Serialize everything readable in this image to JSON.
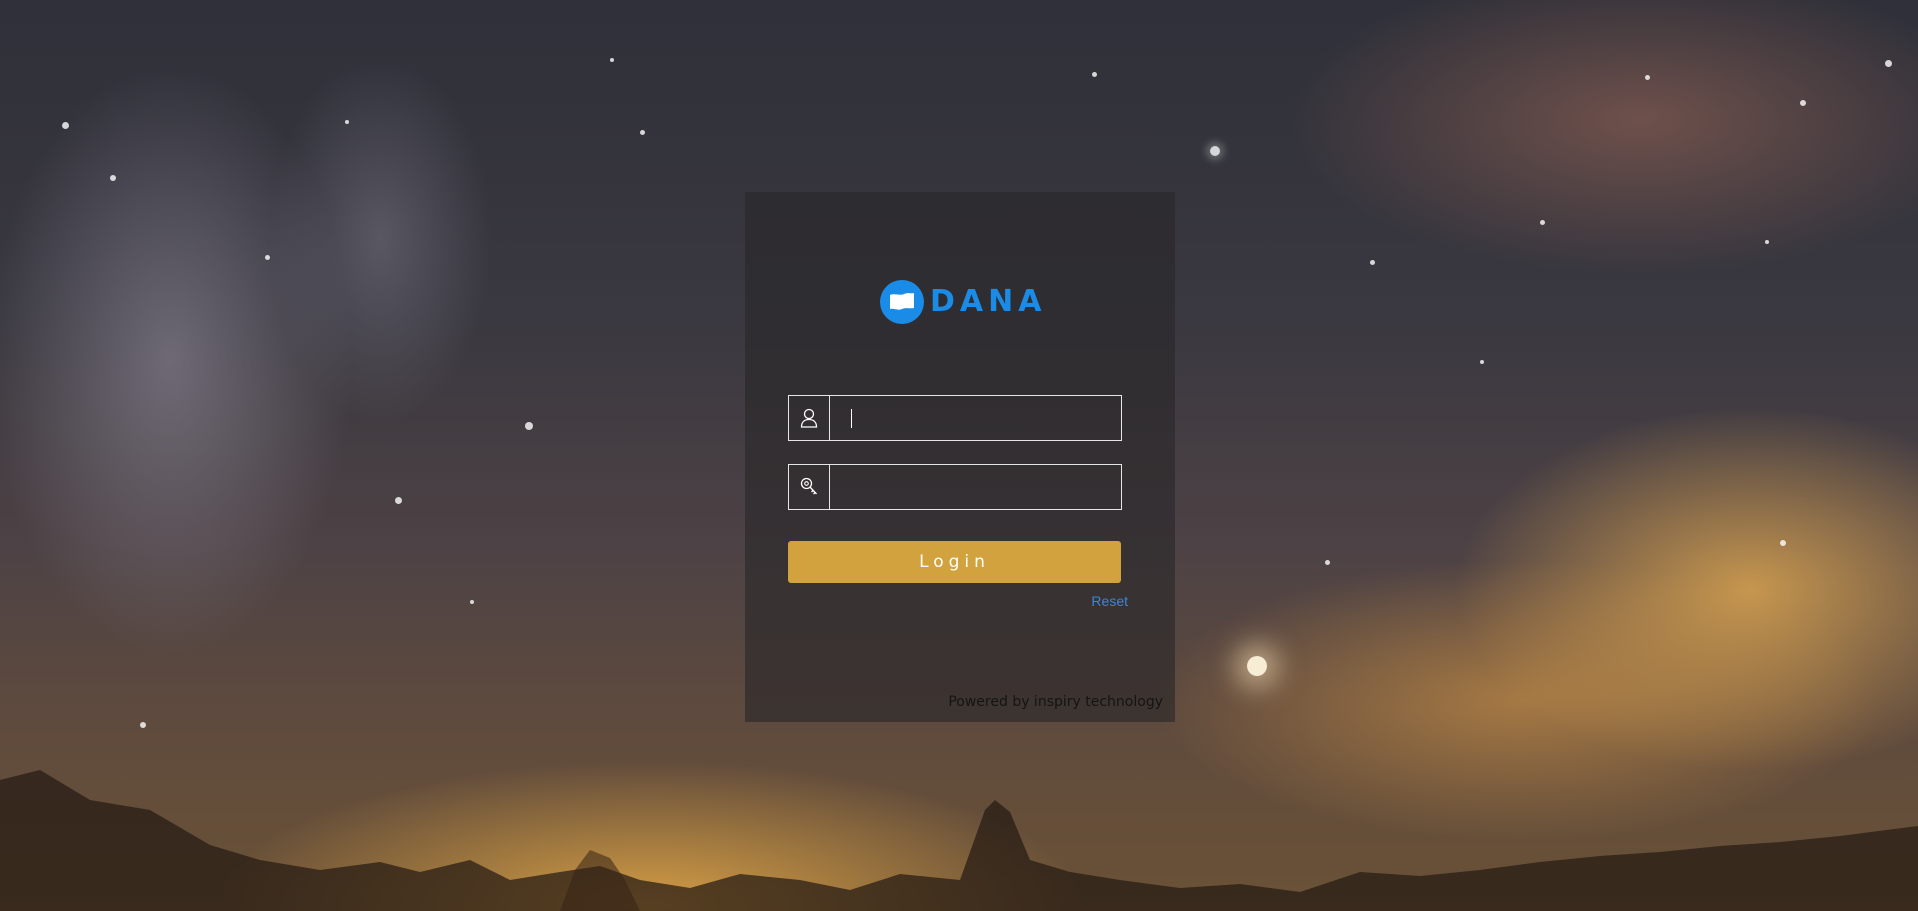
{
  "login_panel": {
    "logo": {
      "icon": "flag-icon",
      "brand_text": "DANA",
      "brand_color": "#1a8be6"
    },
    "username_field": {
      "icon": "user-icon",
      "value": "",
      "placeholder": ""
    },
    "password_field": {
      "icon": "key-icon",
      "value": "",
      "placeholder": ""
    },
    "login_button": {
      "label": "Login",
      "color": "#d2a23f"
    },
    "reset_link": {
      "label": "Reset",
      "color": "#3e86d6"
    },
    "footer": {
      "text": "Powered by inspiry technology"
    }
  }
}
